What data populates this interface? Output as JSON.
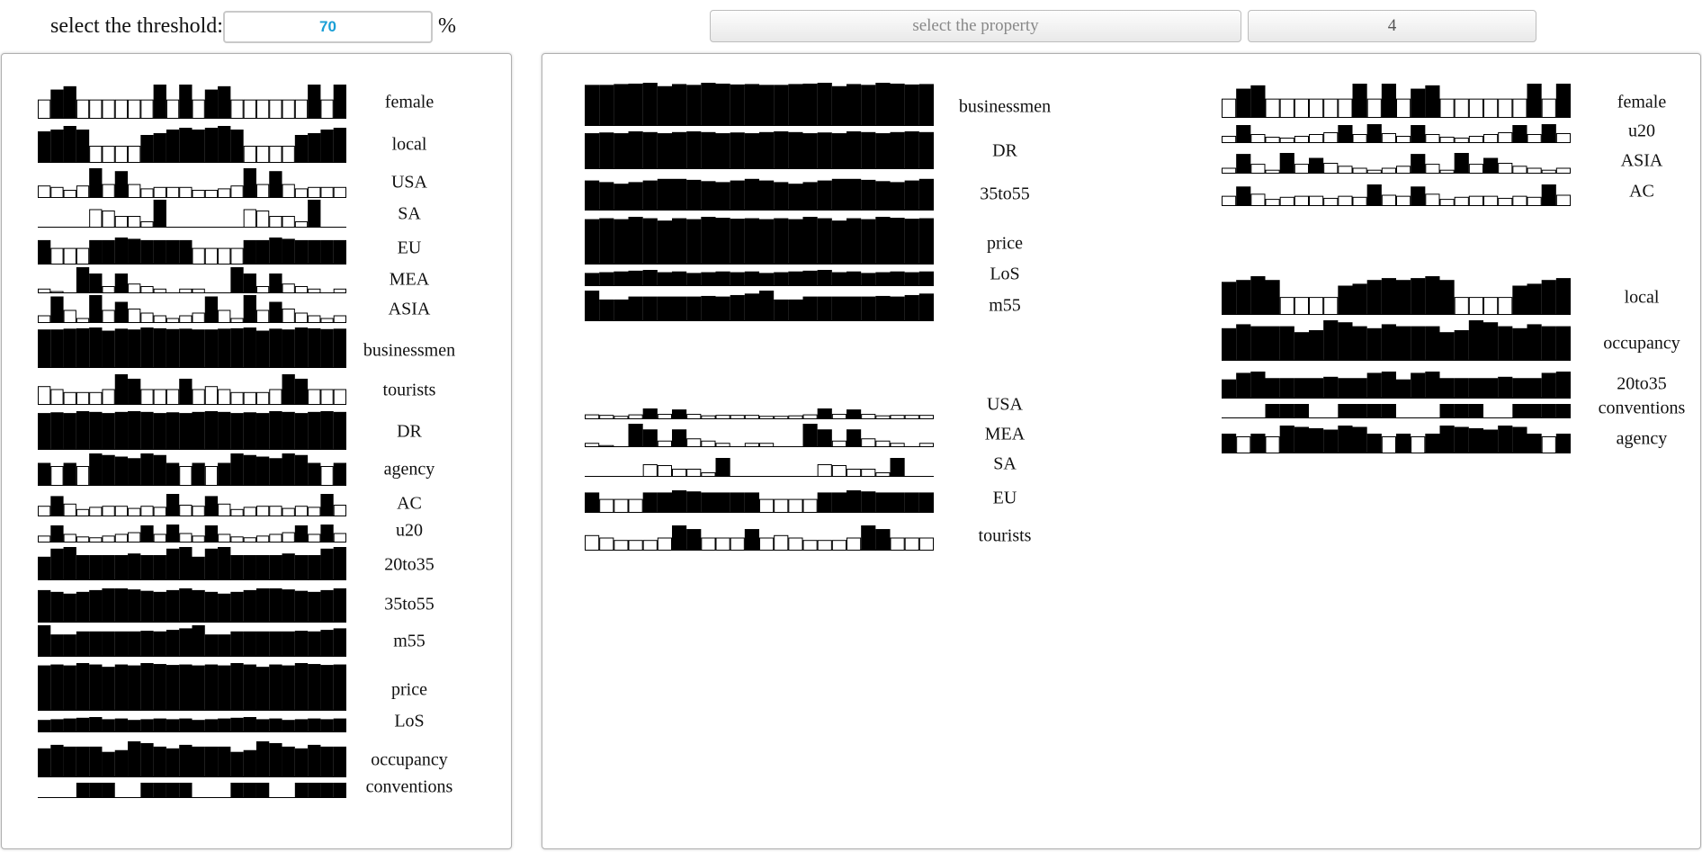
{
  "toolbar": {
    "threshold_label": "select the threshold:",
    "threshold_value": "70",
    "threshold_unit": "%",
    "property_button": "select the property",
    "cluster_count_button": "4"
  },
  "attributes": {
    "female": [
      0.55,
      0.85,
      0.95,
      0.55,
      0.55,
      0.55,
      0.55,
      0.55,
      0.55,
      1.0,
      0.55,
      1.0,
      0.55,
      0.85,
      0.95,
      0.55,
      0.55,
      0.55,
      0.55,
      0.55,
      0.55,
      1.0,
      0.55,
      1.0
    ],
    "local": [
      0.85,
      0.9,
      1.0,
      0.9,
      0.45,
      0.45,
      0.45,
      0.45,
      0.75,
      0.8,
      0.9,
      0.95,
      0.9,
      0.95,
      1.0,
      0.9,
      0.45,
      0.45,
      0.45,
      0.45,
      0.75,
      0.8,
      0.9,
      0.95
    ],
    "USA": [
      0.4,
      0.35,
      0.25,
      0.4,
      1.0,
      0.45,
      0.9,
      0.45,
      0.3,
      0.35,
      0.35,
      0.35,
      0.25,
      0.25,
      0.3,
      0.4,
      1.0,
      0.45,
      0.9,
      0.45,
      0.3,
      0.35,
      0.35,
      0.35
    ],
    "SA": [
      0.0,
      0.0,
      0.0,
      0.0,
      0.65,
      0.6,
      0.4,
      0.4,
      0.2,
      1.0,
      0.0,
      0.0,
      0.0,
      0.0,
      0.0,
      0.0,
      0.65,
      0.6,
      0.4,
      0.4,
      0.2,
      1.0,
      0.0,
      0.0
    ],
    "EU": [
      0.9,
      0.6,
      0.6,
      0.6,
      0.9,
      0.9,
      1.0,
      0.95,
      0.9,
      0.9,
      0.9,
      0.9,
      0.6,
      0.6,
      0.6,
      0.6,
      0.9,
      0.9,
      1.0,
      0.95,
      0.9,
      0.9,
      0.9,
      0.9
    ],
    "MEA": [
      0.15,
      0.05,
      0.0,
      1.0,
      0.75,
      0.25,
      0.75,
      0.35,
      0.25,
      0.15,
      0.0,
      0.15,
      0.15,
      0.0,
      0.0,
      1.0,
      0.75,
      0.25,
      0.75,
      0.35,
      0.25,
      0.15,
      0.0,
      0.15
    ],
    "ASIA": [
      0.25,
      0.95,
      0.45,
      0.15,
      1.0,
      0.45,
      0.75,
      0.5,
      0.35,
      0.25,
      0.15,
      0.25,
      0.35,
      0.95,
      0.45,
      0.15,
      1.0,
      0.45,
      0.75,
      0.5,
      0.35,
      0.25,
      0.15,
      0.25
    ],
    "businessmen": [
      0.95,
      0.95,
      0.97,
      0.98,
      1.0,
      0.92,
      0.97,
      0.95,
      1.0,
      0.98,
      0.96,
      0.97,
      0.95,
      0.95,
      0.97,
      0.98,
      1.0,
      0.92,
      0.97,
      0.95,
      1.0,
      0.98,
      0.96,
      0.97
    ],
    "tourists": [
      0.6,
      0.5,
      0.4,
      0.4,
      0.4,
      0.5,
      1.0,
      0.85,
      0.5,
      0.5,
      0.5,
      0.85,
      0.5,
      0.6,
      0.5,
      0.4,
      0.4,
      0.4,
      0.5,
      1.0,
      0.85,
      0.5,
      0.5,
      0.5
    ],
    "DR": [
      0.95,
      0.97,
      0.95,
      1.0,
      0.98,
      0.95,
      0.98,
      1.0,
      0.98,
      0.95,
      0.97,
      0.95,
      0.98,
      1.0,
      0.98,
      0.95,
      0.97,
      0.95,
      1.0,
      0.98,
      0.95,
      0.98,
      1.0,
      0.98
    ],
    "agency": [
      0.7,
      0.6,
      0.7,
      0.6,
      1.0,
      0.95,
      0.9,
      0.85,
      1.0,
      0.95,
      0.7,
      0.6,
      0.7,
      0.6,
      0.7,
      1.0,
      0.95,
      0.9,
      0.85,
      1.0,
      0.95,
      0.7,
      0.6,
      0.7
    ],
    "AC": [
      0.45,
      0.9,
      0.55,
      0.3,
      0.4,
      0.45,
      0.45,
      0.35,
      0.45,
      0.4,
      1.0,
      0.5,
      0.45,
      0.9,
      0.55,
      0.3,
      0.4,
      0.45,
      0.45,
      0.35,
      0.45,
      0.4,
      1.0,
      0.5
    ],
    "u20": [
      0.35,
      0.95,
      0.45,
      0.3,
      0.25,
      0.35,
      0.45,
      0.55,
      0.95,
      0.45,
      1.0,
      0.5,
      0.35,
      0.95,
      0.45,
      0.3,
      0.25,
      0.35,
      0.45,
      0.55,
      0.95,
      0.45,
      1.0,
      0.5
    ],
    "20to35": [
      0.7,
      0.95,
      1.0,
      0.75,
      0.75,
      0.75,
      0.75,
      0.8,
      0.75,
      0.75,
      0.95,
      1.0,
      0.7,
      0.95,
      1.0,
      0.75,
      0.75,
      0.75,
      0.75,
      0.8,
      0.75,
      0.75,
      0.95,
      1.0
    ],
    "35to55": [
      0.9,
      0.85,
      0.8,
      0.85,
      0.9,
      0.95,
      0.95,
      0.92,
      0.88,
      0.85,
      0.9,
      0.95,
      0.9,
      0.85,
      0.8,
      0.85,
      0.9,
      0.95,
      0.95,
      0.92,
      0.88,
      0.85,
      0.9,
      0.95
    ],
    "m55": [
      1.0,
      0.7,
      0.7,
      0.8,
      0.8,
      0.8,
      0.8,
      0.8,
      0.82,
      0.8,
      0.85,
      0.9,
      1.0,
      0.7,
      0.7,
      0.8,
      0.8,
      0.8,
      0.8,
      0.8,
      0.82,
      0.8,
      0.85,
      0.9
    ],
    "price": [
      0.95,
      0.97,
      0.95,
      1.0,
      0.97,
      0.92,
      0.97,
      0.95,
      1.0,
      0.98,
      0.96,
      0.97,
      0.95,
      0.97,
      0.95,
      1.0,
      0.97,
      0.92,
      0.97,
      0.95,
      1.0,
      0.98,
      0.96,
      0.97
    ],
    "LoS": [
      0.8,
      0.85,
      0.9,
      0.95,
      1.0,
      0.85,
      0.9,
      0.8,
      0.85,
      0.9,
      0.85,
      0.9,
      0.8,
      0.85,
      0.9,
      0.95,
      1.0,
      0.85,
      0.9,
      0.8,
      0.85,
      0.9,
      0.85,
      0.9
    ],
    "occupancy": [
      0.8,
      0.9,
      0.85,
      0.85,
      0.85,
      0.7,
      0.75,
      1.0,
      0.95,
      0.85,
      0.8,
      0.9,
      0.85,
      0.85,
      0.85,
      0.7,
      0.75,
      1.0,
      0.95,
      0.85,
      0.8,
      0.9,
      0.85,
      0.85
    ],
    "conventions": [
      0.0,
      0.0,
      0.0,
      1.0,
      1.0,
      1.0,
      0.0,
      0.0,
      1.0,
      1.0,
      1.0,
      1.0,
      0.0,
      0.0,
      0.0,
      1.0,
      1.0,
      1.0,
      0.0,
      0.0,
      1.0,
      1.0,
      1.0,
      1.0
    ]
  },
  "panels": {
    "overview": [
      "female",
      "local",
      "USA",
      "SA",
      "EU",
      "MEA",
      "ASIA",
      "businessmen",
      "tourists",
      "DR",
      "agency",
      "AC",
      "u20",
      "20to35",
      "35to55",
      "m55",
      "price",
      "LoS",
      "occupancy",
      "conventions"
    ],
    "clusters": [
      [
        "businessmen",
        "DR",
        "35to55",
        "price",
        "LoS",
        "m55"
      ],
      [
        "USA",
        "MEA",
        "SA",
        "EU",
        "tourists"
      ],
      [
        "female",
        "u20",
        "ASIA",
        "AC"
      ],
      [
        "local",
        "occupancy",
        "20to35",
        "conventions",
        "agency"
      ]
    ]
  }
}
